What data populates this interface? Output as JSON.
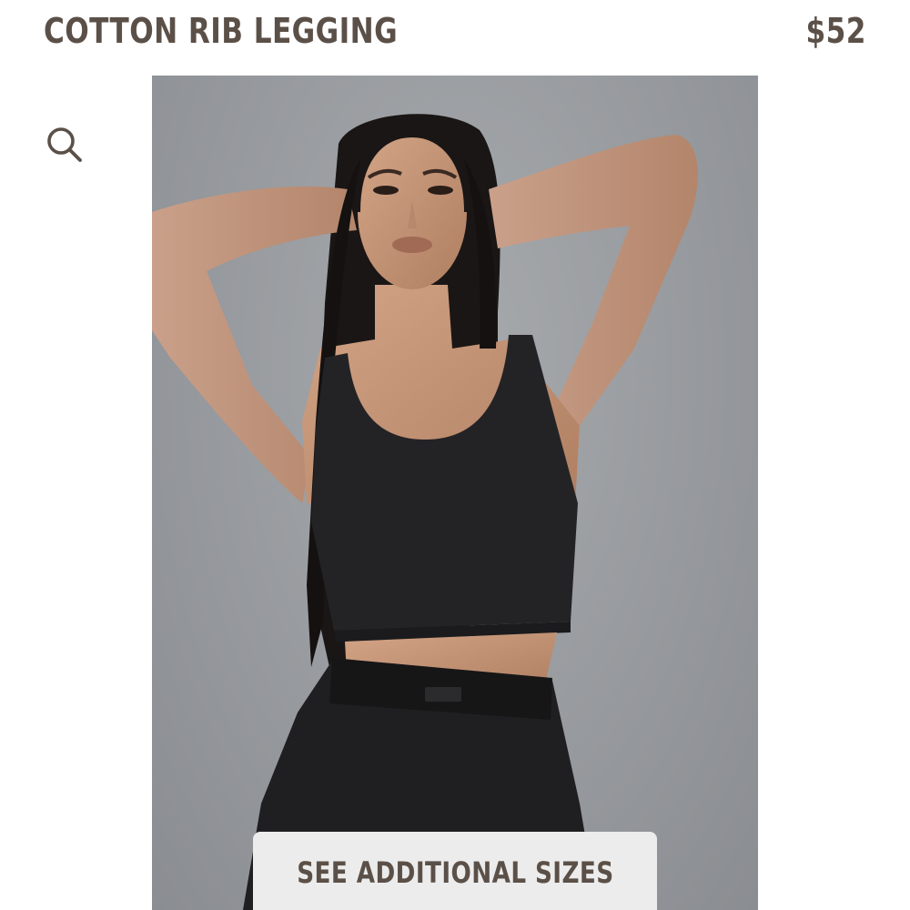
{
  "product": {
    "title": "COTTON RIB LEGGING",
    "price": "$52"
  },
  "search": {
    "icon": "search-icon"
  },
  "image": {
    "subject": "product-model-photo"
  },
  "sizes_button": {
    "label": "SEE ADDITIONAL SIZES"
  },
  "colors": {
    "text": "#5b5048",
    "button_bg": "#ececec",
    "photo_bg": "#979a9e"
  }
}
